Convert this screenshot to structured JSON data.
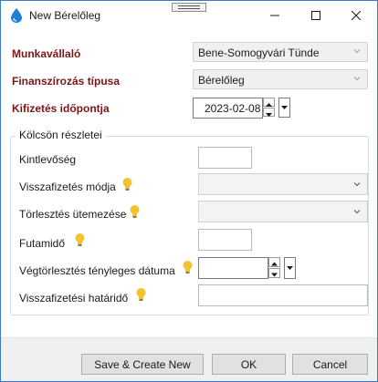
{
  "window": {
    "title": "New Bérelőleg"
  },
  "form": {
    "employee": {
      "label": "Munkavállaló",
      "value": "Bene-Somogyvári Tünde"
    },
    "financing_type": {
      "label": "Finanszírozás típusa",
      "value": "Bérelőleg"
    },
    "payment_date": {
      "label": "Kifizetés időpontja",
      "value": "2023-02-08"
    }
  },
  "loan_details": {
    "title": "Kölcsön részletei",
    "outstanding": {
      "label": "Kintlevőség",
      "value": ""
    },
    "repayment_method": {
      "label": "Visszafizetés módja",
      "value": ""
    },
    "repayment_schedule": {
      "label": "Törlesztés ütemezése",
      "value": ""
    },
    "term": {
      "label": "Futamidő",
      "value": ""
    },
    "final_repayment_date": {
      "label": "Végtörlesztés tényleges dátuma",
      "value": ""
    },
    "repayment_deadline": {
      "label": "Visszafizetési határidő",
      "value": ""
    }
  },
  "buttons": {
    "save_create_new": "Save & Create New",
    "ok": "OK",
    "cancel": "Cancel"
  },
  "colors": {
    "required_label": "#7a1616",
    "window_border": "#3b79c4",
    "hint_bulb": "#f2c230"
  }
}
